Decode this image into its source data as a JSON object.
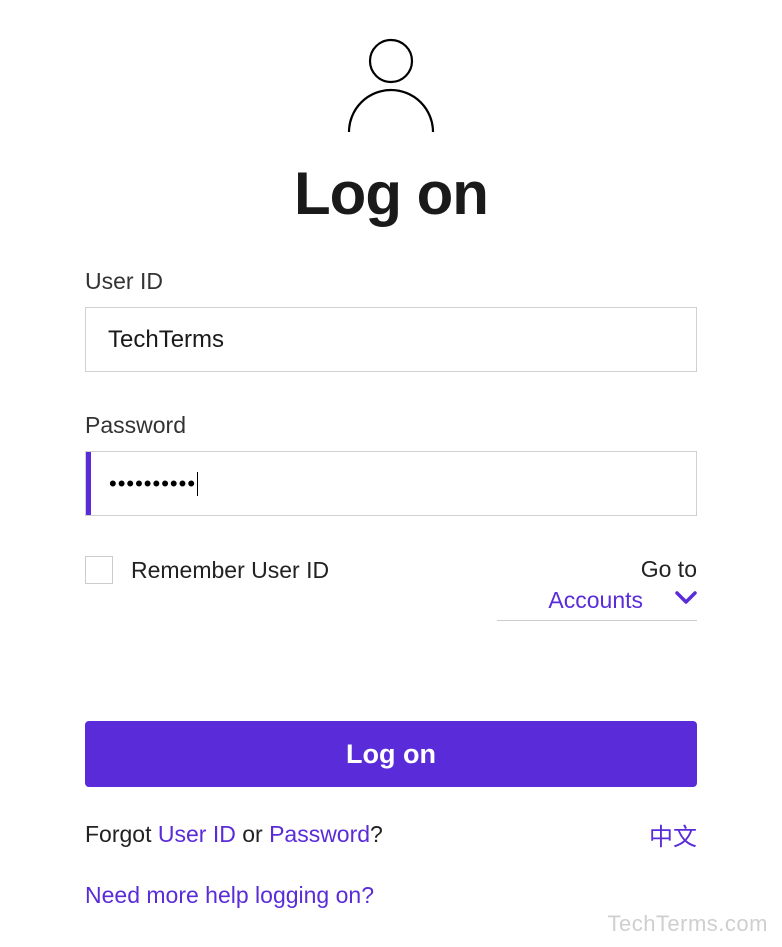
{
  "title": "Log on",
  "fields": {
    "user_id": {
      "label": "User ID",
      "value": "TechTerms"
    },
    "password": {
      "label": "Password",
      "masked_value": "••••••••••"
    }
  },
  "options": {
    "remember_label": "Remember User ID",
    "goto_label": "Go to",
    "goto_value": "Accounts"
  },
  "submit_label": "Log on",
  "forgot": {
    "prefix": "Forgot ",
    "user_id": "User ID",
    "sep": " or ",
    "password": "Password",
    "suffix": "?"
  },
  "language_link": "中文",
  "help_link": "Need more help logging on?",
  "watermark": "TechTerms.com",
  "colors": {
    "accent": "#5a2cd9"
  }
}
